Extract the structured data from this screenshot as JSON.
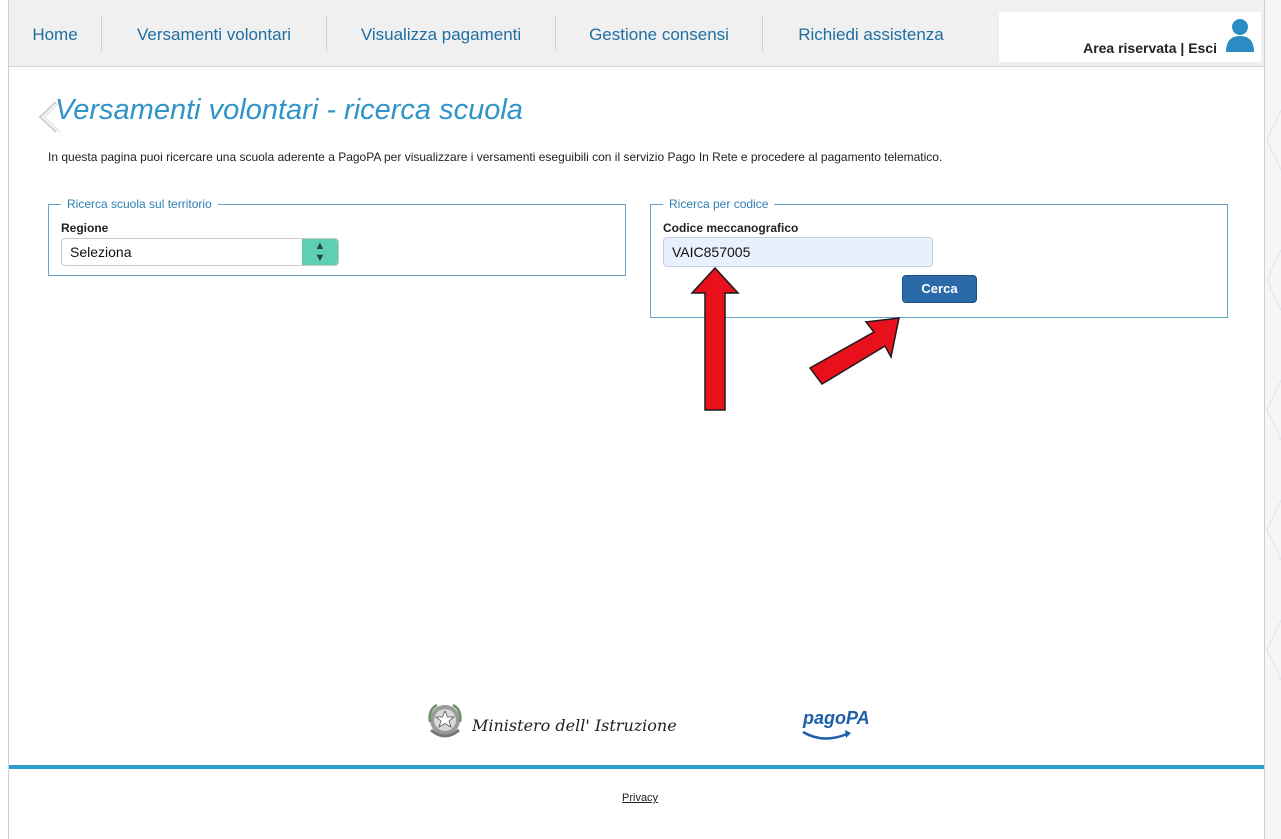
{
  "nav": {
    "items": [
      {
        "label": "Home"
      },
      {
        "label": "Versamenti volontari"
      },
      {
        "label": "Visualizza pagamenti"
      },
      {
        "label": "Gestione consensi"
      },
      {
        "label": "Richiedi assistenza"
      }
    ],
    "area_riservata": "Area riservata",
    "separator": "|",
    "esci": "Esci",
    "user_icon": "user-icon"
  },
  "page": {
    "title": "Versamenti volontari - ricerca scuola",
    "intro": "In questa pagina puoi ricercare una scuola aderente a PagoPA per visualizzare i versamenti eseguibili con il servizio Pago In Rete e procedere al pagamento telematico."
  },
  "ricerca_territorio": {
    "legend": "Ricerca scuola sul territorio",
    "regione_label": "Regione",
    "regione_value": "Seleziona",
    "select_icon": "updown-arrows-icon"
  },
  "ricerca_codice": {
    "legend": "Ricerca per codice",
    "codice_label": "Codice meccanografico",
    "codice_value": "VAIC857005",
    "button_label": "Cerca"
  },
  "annotations": {
    "arrow_color": "#e8101a",
    "arrows": [
      "up-arrow-to-code-field",
      "diagonal-arrow-to-cerca-button"
    ]
  },
  "footer": {
    "ministero": "Ministero dell' Istruzione",
    "pagopa": "pagoPA",
    "privacy": "Privacy",
    "accent_color": "#2c9ccf"
  },
  "colors": {
    "nav_text": "#1f6fa3",
    "title": "#2f94c8",
    "button": "#2b6aa8",
    "select_arrow": "#5ccfb5"
  }
}
